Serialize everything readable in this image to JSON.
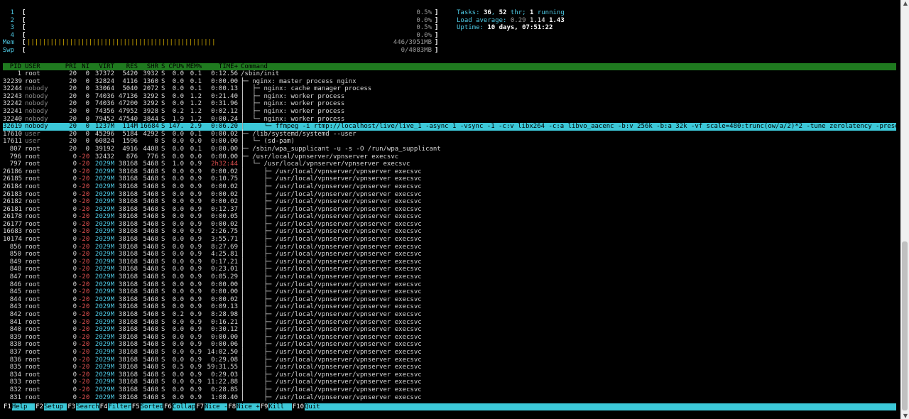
{
  "meters": [
    {
      "label": "1",
      "value": "0.5%",
      "bar": "",
      "bar_color": "#5fd75f"
    },
    {
      "label": "2",
      "value": "0.0%",
      "bar": "",
      "bar_color": "#5fd75f"
    },
    {
      "label": "3",
      "value": "0.5%",
      "bar": "",
      "bar_color": "#5fd75f"
    },
    {
      "label": "4",
      "value": "0.0%",
      "bar": "",
      "bar_color": "#5fd75f"
    },
    {
      "label": "Mem",
      "value": "446/3951MB",
      "bar": "|||||||||||||||||||||||||||||||||||||||||||||||||",
      "bar_color": "#d7af00"
    },
    {
      "label": "Swp",
      "value": "0/4083MB",
      "bar": "",
      "bar_color": "#e05050"
    }
  ],
  "tasks": {
    "tasks_label": "Tasks: ",
    "tasks_count": "36",
    "sep": ", ",
    "thr_count": "52",
    "thr_label": " thr; ",
    "running_count": "1",
    "running_label": " running",
    "load_label": "Load average: ",
    "load1": "0.29",
    "load5": "1.14",
    "load15": "1.43",
    "uptime_label": "Uptime: ",
    "uptime": "10 days, 07:51:22"
  },
  "header": {
    "pid": "PID",
    "user": "USER",
    "pri": "PRI",
    "ni": "NI",
    "virt": "VIRT",
    "res": "RES",
    "shr": "SHR",
    "s": "S",
    "cpu": "CPU%",
    "mem": "MEM%",
    "time": "TIME+",
    "cmd": "Command"
  },
  "processes": [
    {
      "pid": "1",
      "user": "root",
      "pri": "20",
      "ni": "0",
      "virt": "37372",
      "res": "5420",
      "shr": "3932",
      "s": "S",
      "cpu": "0.0",
      "mem": "0.1",
      "time": "0:12.56",
      "cmd": "/sbin/init"
    },
    {
      "pid": "32239",
      "user": "root",
      "pri": "20",
      "ni": "0",
      "virt": "32824",
      "res": "4116",
      "shr": "1360",
      "s": "S",
      "cpu": "0.0",
      "mem": "0.1",
      "time": "0:00.00",
      "cmd": "├─ nginx: master process nginx"
    },
    {
      "pid": "32244",
      "user": "nobody",
      "pri": "20",
      "ni": "0",
      "virt": "33064",
      "res": "5040",
      "shr": "2072",
      "s": "S",
      "cpu": "0.0",
      "mem": "0.1",
      "time": "0:00.13",
      "cmd": "│  ├─ nginx: cache manager process"
    },
    {
      "pid": "32243",
      "user": "nobody",
      "pri": "20",
      "ni": "0",
      "virt": "74036",
      "res": "47136",
      "shr": "3292",
      "s": "S",
      "cpu": "0.0",
      "mem": "1.2",
      "time": "0:21.40",
      "cmd": "│  ├─ nginx: worker process"
    },
    {
      "pid": "32242",
      "user": "nobody",
      "pri": "20",
      "ni": "0",
      "virt": "74036",
      "res": "47200",
      "shr": "3292",
      "s": "S",
      "cpu": "0.0",
      "mem": "1.2",
      "time": "0:31.96",
      "cmd": "│  ├─ nginx: worker process"
    },
    {
      "pid": "32241",
      "user": "nobody",
      "pri": "20",
      "ni": "0",
      "virt": "74356",
      "res": "47952",
      "shr": "3928",
      "s": "S",
      "cpu": "0.2",
      "mem": "1.2",
      "time": "0:02.12",
      "cmd": "│  ├─ nginx: worker process"
    },
    {
      "pid": "32240",
      "user": "nobody",
      "pri": "20",
      "ni": "0",
      "virt": "79452",
      "res": "47540",
      "shr": "3844",
      "s": "S",
      "cpu": "1.9",
      "mem": "1.2",
      "time": "0:00.24",
      "cmd": "│  └─ nginx: worker process"
    },
    {
      "pid": "32619",
      "user": "nobody",
      "pri": "20",
      "ni": "0",
      "virt": "1237M",
      "res": "114M",
      "shr": "16684",
      "s": "S",
      "cpu": "147.",
      "mem": "2.9",
      "time": "0:06.20",
      "cmd": "│     └─ ffmpeg -i rtmp://localhost/live/live_1 -async 1 -vsync -1 -c:v libx264 -c:a libvo_aacenc -b:v 256k -b:a 32k -vf scale=480:trunc(ow/a/2)*2 -tune zerolatency -preset",
      "selected": true
    },
    {
      "pid": "17610",
      "user": "user",
      "pri": "20",
      "ni": "0",
      "virt": "45296",
      "res": "5184",
      "shr": "4292",
      "s": "S",
      "cpu": "0.0",
      "mem": "0.1",
      "time": "0:00.02",
      "cmd": "├─ /lib/systemd/systemd --user"
    },
    {
      "pid": "17611",
      "user": "user",
      "pri": "20",
      "ni": "0",
      "virt": "60824",
      "res": "1596",
      "shr": "0",
      "s": "S",
      "cpu": "0.0",
      "mem": "0.0",
      "time": "0:00.00",
      "cmd": "│  └─ (sd-pam)"
    },
    {
      "pid": "807",
      "user": "root",
      "pri": "20",
      "ni": "0",
      "virt": "39192",
      "res": "4916",
      "shr": "4408",
      "s": "S",
      "cpu": "0.0",
      "mem": "0.1",
      "time": "0:00.00",
      "cmd": "├─ /sbin/wpa_supplicant -u -s -O /run/wpa_supplicant"
    },
    {
      "pid": "796",
      "user": "root",
      "pri": "0",
      "ni": "-20",
      "virt": "32432",
      "res": "876",
      "shr": "776",
      "s": "S",
      "cpu": "0.0",
      "mem": "0.0",
      "time": "0:00.00",
      "cmd": "├─ /usr/local/vpnserver/vpnserver execsvc"
    },
    {
      "pid": "797",
      "user": "root",
      "pri": "0",
      "ni": "-20",
      "virt": "2029M",
      "res": "38168",
      "shr": "5468",
      "s": "S",
      "cpu": "1.0",
      "mem": "0.9",
      "time": "2h32:44",
      "cmd": "│  └─ /usr/local/vpnserver/vpnserver execsvc",
      "time_hl": true
    },
    {
      "pid": "26186",
      "user": "root",
      "pri": "0",
      "ni": "-20",
      "virt": "2029M",
      "res": "38168",
      "shr": "5468",
      "s": "S",
      "cpu": "0.0",
      "mem": "0.9",
      "time": "0:00.02",
      "cmd": "│     ├─ /usr/local/vpnserver/vpnserver execsvc"
    },
    {
      "pid": "26185",
      "user": "root",
      "pri": "0",
      "ni": "-20",
      "virt": "2029M",
      "res": "38168",
      "shr": "5468",
      "s": "S",
      "cpu": "0.0",
      "mem": "0.9",
      "time": "0:10.75",
      "cmd": "│     ├─ /usr/local/vpnserver/vpnserver execsvc"
    },
    {
      "pid": "26184",
      "user": "root",
      "pri": "0",
      "ni": "-20",
      "virt": "2029M",
      "res": "38168",
      "shr": "5468",
      "s": "S",
      "cpu": "0.0",
      "mem": "0.9",
      "time": "0:00.02",
      "cmd": "│     ├─ /usr/local/vpnserver/vpnserver execsvc"
    },
    {
      "pid": "26183",
      "user": "root",
      "pri": "0",
      "ni": "-20",
      "virt": "2029M",
      "res": "38168",
      "shr": "5468",
      "s": "S",
      "cpu": "0.0",
      "mem": "0.9",
      "time": "0:00.02",
      "cmd": "│     ├─ /usr/local/vpnserver/vpnserver execsvc"
    },
    {
      "pid": "26182",
      "user": "root",
      "pri": "0",
      "ni": "-20",
      "virt": "2029M",
      "res": "38168",
      "shr": "5468",
      "s": "S",
      "cpu": "0.0",
      "mem": "0.9",
      "time": "0:00.02",
      "cmd": "│     ├─ /usr/local/vpnserver/vpnserver execsvc"
    },
    {
      "pid": "26181",
      "user": "root",
      "pri": "0",
      "ni": "-20",
      "virt": "2029M",
      "res": "38168",
      "shr": "5468",
      "s": "S",
      "cpu": "0.0",
      "mem": "0.9",
      "time": "0:12.37",
      "cmd": "│     ├─ /usr/local/vpnserver/vpnserver execsvc"
    },
    {
      "pid": "26178",
      "user": "root",
      "pri": "0",
      "ni": "-20",
      "virt": "2029M",
      "res": "38168",
      "shr": "5468",
      "s": "S",
      "cpu": "0.0",
      "mem": "0.9",
      "time": "0:00.05",
      "cmd": "│     ├─ /usr/local/vpnserver/vpnserver execsvc"
    },
    {
      "pid": "26177",
      "user": "root",
      "pri": "0",
      "ni": "-20",
      "virt": "2029M",
      "res": "38168",
      "shr": "5468",
      "s": "S",
      "cpu": "0.0",
      "mem": "0.9",
      "time": "0:00.02",
      "cmd": "│     ├─ /usr/local/vpnserver/vpnserver execsvc"
    },
    {
      "pid": "16683",
      "user": "root",
      "pri": "0",
      "ni": "-20",
      "virt": "2029M",
      "res": "38168",
      "shr": "5468",
      "s": "S",
      "cpu": "0.0",
      "mem": "0.9",
      "time": "2:26.75",
      "cmd": "│     ├─ /usr/local/vpnserver/vpnserver execsvc"
    },
    {
      "pid": "10174",
      "user": "root",
      "pri": "0",
      "ni": "-20",
      "virt": "2029M",
      "res": "38168",
      "shr": "5468",
      "s": "S",
      "cpu": "0.0",
      "mem": "0.9",
      "time": "3:55.71",
      "cmd": "│     ├─ /usr/local/vpnserver/vpnserver execsvc"
    },
    {
      "pid": "856",
      "user": "root",
      "pri": "0",
      "ni": "-20",
      "virt": "2029M",
      "res": "38168",
      "shr": "5468",
      "s": "S",
      "cpu": "0.0",
      "mem": "0.9",
      "time": "8:27.69",
      "cmd": "│     ├─ /usr/local/vpnserver/vpnserver execsvc"
    },
    {
      "pid": "850",
      "user": "root",
      "pri": "0",
      "ni": "-20",
      "virt": "2029M",
      "res": "38168",
      "shr": "5468",
      "s": "S",
      "cpu": "0.0",
      "mem": "0.9",
      "time": "4:25.81",
      "cmd": "│     ├─ /usr/local/vpnserver/vpnserver execsvc"
    },
    {
      "pid": "849",
      "user": "root",
      "pri": "0",
      "ni": "-20",
      "virt": "2029M",
      "res": "38168",
      "shr": "5468",
      "s": "S",
      "cpu": "0.0",
      "mem": "0.9",
      "time": "0:17.21",
      "cmd": "│     ├─ /usr/local/vpnserver/vpnserver execsvc"
    },
    {
      "pid": "848",
      "user": "root",
      "pri": "0",
      "ni": "-20",
      "virt": "2029M",
      "res": "38168",
      "shr": "5468",
      "s": "S",
      "cpu": "0.0",
      "mem": "0.9",
      "time": "0:23.01",
      "cmd": "│     ├─ /usr/local/vpnserver/vpnserver execsvc"
    },
    {
      "pid": "847",
      "user": "root",
      "pri": "0",
      "ni": "-20",
      "virt": "2029M",
      "res": "38168",
      "shr": "5468",
      "s": "S",
      "cpu": "0.0",
      "mem": "0.9",
      "time": "0:05.29",
      "cmd": "│     ├─ /usr/local/vpnserver/vpnserver execsvc"
    },
    {
      "pid": "846",
      "user": "root",
      "pri": "0",
      "ni": "-20",
      "virt": "2029M",
      "res": "38168",
      "shr": "5468",
      "s": "S",
      "cpu": "0.0",
      "mem": "0.9",
      "time": "0:00.00",
      "cmd": "│     ├─ /usr/local/vpnserver/vpnserver execsvc"
    },
    {
      "pid": "845",
      "user": "root",
      "pri": "0",
      "ni": "-20",
      "virt": "2029M",
      "res": "38168",
      "shr": "5468",
      "s": "S",
      "cpu": "0.0",
      "mem": "0.9",
      "time": "0:00.00",
      "cmd": "│     ├─ /usr/local/vpnserver/vpnserver execsvc"
    },
    {
      "pid": "844",
      "user": "root",
      "pri": "0",
      "ni": "-20",
      "virt": "2029M",
      "res": "38168",
      "shr": "5468",
      "s": "S",
      "cpu": "0.0",
      "mem": "0.9",
      "time": "0:00.02",
      "cmd": "│     ├─ /usr/local/vpnserver/vpnserver execsvc"
    },
    {
      "pid": "843",
      "user": "root",
      "pri": "0",
      "ni": "-20",
      "virt": "2029M",
      "res": "38168",
      "shr": "5468",
      "s": "S",
      "cpu": "0.0",
      "mem": "0.9",
      "time": "0:09.13",
      "cmd": "│     ├─ /usr/local/vpnserver/vpnserver execsvc"
    },
    {
      "pid": "842",
      "user": "root",
      "pri": "0",
      "ni": "-20",
      "virt": "2029M",
      "res": "38168",
      "shr": "5468",
      "s": "S",
      "cpu": "0.2",
      "mem": "0.9",
      "time": "8:28.98",
      "cmd": "│     ├─ /usr/local/vpnserver/vpnserver execsvc"
    },
    {
      "pid": "841",
      "user": "root",
      "pri": "0",
      "ni": "-20",
      "virt": "2029M",
      "res": "38168",
      "shr": "5468",
      "s": "S",
      "cpu": "0.0",
      "mem": "0.9",
      "time": "0:16.21",
      "cmd": "│     ├─ /usr/local/vpnserver/vpnserver execsvc"
    },
    {
      "pid": "840",
      "user": "root",
      "pri": "0",
      "ni": "-20",
      "virt": "2029M",
      "res": "38168",
      "shr": "5468",
      "s": "S",
      "cpu": "0.0",
      "mem": "0.9",
      "time": "0:30.12",
      "cmd": "│     ├─ /usr/local/vpnserver/vpnserver execsvc"
    },
    {
      "pid": "839",
      "user": "root",
      "pri": "0",
      "ni": "-20",
      "virt": "2029M",
      "res": "38168",
      "shr": "5468",
      "s": "S",
      "cpu": "0.0",
      "mem": "0.9",
      "time": "0:00.00",
      "cmd": "│     ├─ /usr/local/vpnserver/vpnserver execsvc"
    },
    {
      "pid": "838",
      "user": "root",
      "pri": "0",
      "ni": "-20",
      "virt": "2029M",
      "res": "38168",
      "shr": "5468",
      "s": "S",
      "cpu": "0.0",
      "mem": "0.9",
      "time": "0:00.06",
      "cmd": "│     ├─ /usr/local/vpnserver/vpnserver execsvc"
    },
    {
      "pid": "837",
      "user": "root",
      "pri": "0",
      "ni": "-20",
      "virt": "2029M",
      "res": "38168",
      "shr": "5468",
      "s": "S",
      "cpu": "0.0",
      "mem": "0.9",
      "time": "14:02.50",
      "cmd": "│     ├─ /usr/local/vpnserver/vpnserver execsvc"
    },
    {
      "pid": "836",
      "user": "root",
      "pri": "0",
      "ni": "-20",
      "virt": "2029M",
      "res": "38168",
      "shr": "5468",
      "s": "S",
      "cpu": "0.0",
      "mem": "0.9",
      "time": "0:29.08",
      "cmd": "│     ├─ /usr/local/vpnserver/vpnserver execsvc"
    },
    {
      "pid": "835",
      "user": "root",
      "pri": "0",
      "ni": "-20",
      "virt": "2029M",
      "res": "38168",
      "shr": "5468",
      "s": "S",
      "cpu": "0.5",
      "mem": "0.9",
      "time": "59:31.55",
      "cmd": "│     ├─ /usr/local/vpnserver/vpnserver execsvc"
    },
    {
      "pid": "834",
      "user": "root",
      "pri": "0",
      "ni": "-20",
      "virt": "2029M",
      "res": "38168",
      "shr": "5468",
      "s": "S",
      "cpu": "0.0",
      "mem": "0.9",
      "time": "0:29.03",
      "cmd": "│     ├─ /usr/local/vpnserver/vpnserver execsvc"
    },
    {
      "pid": "833",
      "user": "root",
      "pri": "0",
      "ni": "-20",
      "virt": "2029M",
      "res": "38168",
      "shr": "5468",
      "s": "S",
      "cpu": "0.0",
      "mem": "0.9",
      "time": "11:22.88",
      "cmd": "│     ├─ /usr/local/vpnserver/vpnserver execsvc"
    },
    {
      "pid": "832",
      "user": "root",
      "pri": "0",
      "ni": "-20",
      "virt": "2029M",
      "res": "38168",
      "shr": "5468",
      "s": "S",
      "cpu": "0.0",
      "mem": "0.9",
      "time": "0:28.85",
      "cmd": "│     ├─ /usr/local/vpnserver/vpnserver execsvc"
    },
    {
      "pid": "831",
      "user": "root",
      "pri": "0",
      "ni": "-20",
      "virt": "2029M",
      "res": "38168",
      "shr": "5468",
      "s": "S",
      "cpu": "0.0",
      "mem": "0.9",
      "time": "1:08.40",
      "cmd": "│     ├─ /usr/local/vpnserver/vpnserver execsvc"
    }
  ],
  "function_bar": [
    {
      "key": "F1",
      "label": "Help"
    },
    {
      "key": "F2",
      "label": "Setup"
    },
    {
      "key": "F3",
      "label": "Search"
    },
    {
      "key": "F4",
      "label": "Filter"
    },
    {
      "key": "F5",
      "label": "Sorted"
    },
    {
      "key": "F6",
      "label": "Collap"
    },
    {
      "key": "F7",
      "label": "Nice -"
    },
    {
      "key": "F8",
      "label": "Nice +"
    },
    {
      "key": "F9",
      "label": "Kill"
    },
    {
      "key": "F10",
      "label": "Quit"
    }
  ],
  "colors": {
    "header_bg": "#1f7a1f",
    "selected_bg": "#3cc8d8",
    "fbar_bg": "#3cc8d8",
    "label": "#4ec9e4"
  }
}
